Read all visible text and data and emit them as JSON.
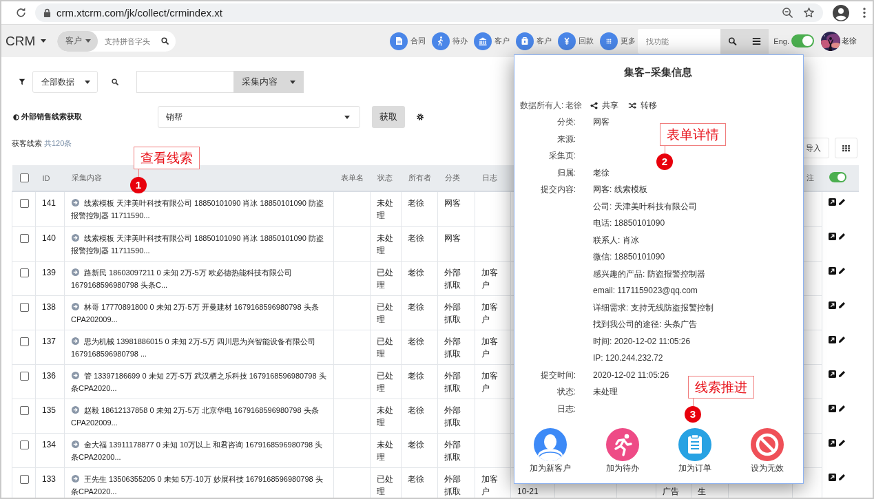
{
  "browser": {
    "url": "crm.xtcrm.com/jk/collect/crmindex.xt"
  },
  "header": {
    "brand": "CRM",
    "search_scope": "客户",
    "search_placeholder": "支持拼音字头",
    "nav": [
      {
        "label": "合同",
        "kind": "document"
      },
      {
        "label": "待办",
        "kind": "walker"
      },
      {
        "label": "客户",
        "kind": "bank"
      },
      {
        "label": "客户",
        "kind": "bag"
      },
      {
        "label": "回款",
        "kind": "yen"
      },
      {
        "label": "更多",
        "kind": "grid"
      }
    ],
    "function_search_placeholder": "找功能",
    "language_label": "Eng.",
    "language_on": true,
    "user": "老徐"
  },
  "toolbar": {
    "scope": "全部数据",
    "search_field": "采集内容",
    "fetch_label": "外部销售线索获取",
    "source": "销帮",
    "fetch_button": "获取",
    "import_button": "导入"
  },
  "list": {
    "title": "获客线索",
    "count": "共120条"
  },
  "table": {
    "all_checked": false,
    "column_toggle_on": true,
    "columns": [
      "ID",
      "采集内容",
      "表单名",
      "状态",
      "所有者",
      "分类",
      "日志",
      "注"
    ],
    "rows": [
      {
        "checked": false,
        "id": "141",
        "content": "线索模板 天津美叶科技有限公司 18850101090 肖冰 18850101090 防盗报警控制器 11711590...",
        "status": "未处理",
        "owner": "老徐",
        "category": "网客"
      },
      {
        "checked": false,
        "id": "140",
        "content": "线索模板 天津美叶科技有限公司 18850101090 肖冰 18850101090 防盗报警控制器 11711590...",
        "status": "未处理",
        "owner": "老徐",
        "category": "网客"
      },
      {
        "checked": false,
        "id": "139",
        "content": "路新民 18603097211 0 未知 2万-5万 欧必德热能科技有限公司 1679168596980798 头条C...",
        "status": "已处理",
        "owner": "老徐",
        "category": "外部抓取",
        "log": "加客户"
      },
      {
        "checked": false,
        "id": "138",
        "content": "林哥 17770891800 0 未知 2万-5万 开曼建材 1679168596980798 头条CPA202009...",
        "status": "已处理",
        "owner": "老徐",
        "category": "外部抓取",
        "log": "加客户"
      },
      {
        "checked": false,
        "id": "137",
        "content": "思为机械 13981886015 0 未知 2万-5万 四川思为兴智能设备有限公司 1679168596980798 ...",
        "status": "已处理",
        "owner": "老徐",
        "category": "外部抓取",
        "log": "加客户"
      },
      {
        "checked": false,
        "id": "136",
        "content": "管 13397186699 0 未知 2万-5万 武汉栖之乐科技 1679168596980798 头条CPA2020...",
        "status": "已处理",
        "owner": "老徐",
        "category": "外部抓取",
        "log": "加客户"
      },
      {
        "checked": false,
        "id": "135",
        "content": "赵毅 18612137858 0 未知 2万-5万 北京华电 1679168596980798 头条CPA202009...",
        "status": "未处理",
        "owner": "老徐",
        "category": "外部抓取"
      },
      {
        "checked": false,
        "id": "134",
        "content": "金大福 13911178877 0 未知 10万以上 和君咨询 1679168596980798 头条CPA20200...",
        "status": "未处理",
        "owner": "老徐",
        "category": "外部抓取"
      },
      {
        "checked": false,
        "id": "133",
        "content": "王先生 13506355205 0 未知 5万-10万 妙展科技 1679168596980798 头条CPA2020...",
        "status": "已处理",
        "owner": "老徐",
        "category": "外部抓取",
        "log": "加客户",
        "column_9": "10-21",
        "column_12": "广告",
        "column_13": "生"
      }
    ]
  },
  "modal": {
    "title": "集客–采集信息",
    "owner_label": "数据所有人:",
    "owner": "老徐",
    "share": "共享",
    "transfer": "转移",
    "fields": [
      {
        "label": "分类:",
        "lines": [
          "网客"
        ]
      },
      {
        "label": "来源:"
      },
      {
        "label": "采集页:"
      },
      {
        "label": "归属:",
        "lines": [
          "老徐"
        ]
      },
      {
        "label": "提交内容:",
        "lines": [
          "网客: 线索模板",
          "公司: 天津美叶科技有限公司",
          "电话: 18850101090",
          "联系人: 肖冰",
          "微信: 18850101090",
          "感兴趣的产品: 防盗报警控制器",
          "email: 1171159023@qq.com",
          "详细需求: 支持无线防盗报警控制",
          "找到我公司的途径: 头条广告",
          "时间: 2020-12-02 11:05:26",
          "IP: 120.244.232.72"
        ]
      },
      {
        "label": "提交时间:",
        "lines": [
          "2020-12-02 11:05:26"
        ]
      },
      {
        "label": "状态:",
        "lines": [
          "未处理"
        ]
      },
      {
        "label": "日志:"
      }
    ],
    "actions": [
      {
        "label": "加为新客户",
        "kind": "person",
        "color": "#3d8af7"
      },
      {
        "label": "加为待办",
        "kind": "runner",
        "color": "#ee4b86"
      },
      {
        "label": "加为订单",
        "kind": "clipboard",
        "color": "#27a2e3"
      },
      {
        "label": "设为无效",
        "kind": "forbidden",
        "color": "#ef5058"
      }
    ]
  },
  "annotations": [
    {
      "number": "1",
      "label": "查看线索"
    },
    {
      "number": "2",
      "label": "表单详情"
    },
    {
      "number": "3",
      "label": "线索推进"
    }
  ]
}
